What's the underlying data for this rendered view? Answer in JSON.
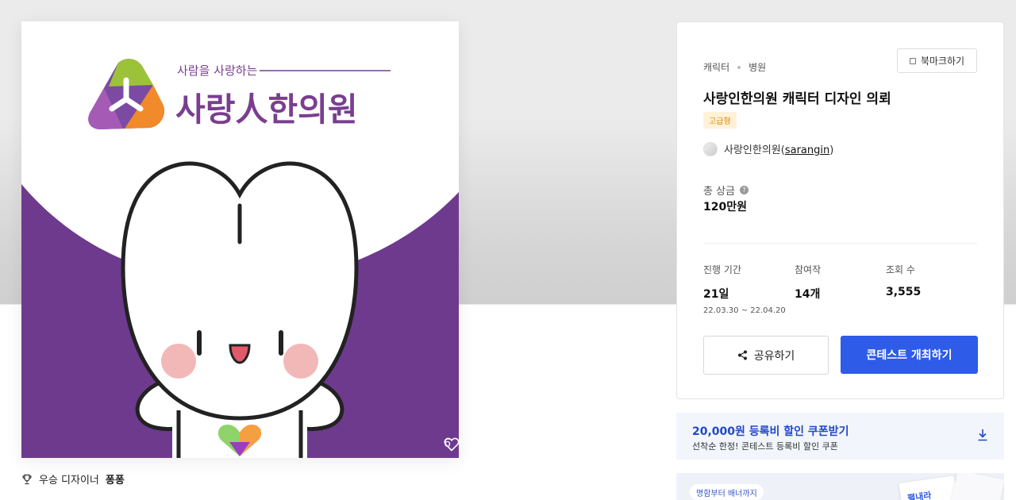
{
  "artwork": {
    "logo_tagline": "사람을 사랑하는",
    "logo_name": "사랑人한의원",
    "like_count": "6",
    "colors": {
      "purple": "#6e3a8e",
      "logo_purple": "#7a3e8f",
      "blush": "#f2b8b8"
    }
  },
  "winner": {
    "label": "우승 디자이너",
    "name": "퐁퐁"
  },
  "info": {
    "breadcrumb": [
      "캐릭터",
      "병원"
    ],
    "bookmark_label": "북마크하기",
    "title": "사랑인한의원 캐릭터 디자인 의뢰",
    "grade_badge": "고급형",
    "host_name": "사랑인한의원",
    "host_handle": "sarangin",
    "prize_label": "총 상금",
    "prize_help": "?",
    "prize_value": "120만원",
    "stats": [
      {
        "label": "진행 기간",
        "value": "21일",
        "sub": "22.03.30 ~ 22.04.20"
      },
      {
        "label": "참여작",
        "value": "14개"
      },
      {
        "label": "조회 수",
        "value": "3,555"
      }
    ],
    "share_label": "공유하기",
    "host_button_label": "콘테스트 개최하기",
    "accent_color": "#2e5be8"
  },
  "coupon": {
    "title": "20,000원 등록비 할인 쿠폰받기",
    "subtitle": "선착순 한정! 콘테스트 등록비 할인 쿠폰"
  },
  "banner": {
    "tag": "명함부터 배너까지",
    "promo_text": "펼내라"
  }
}
